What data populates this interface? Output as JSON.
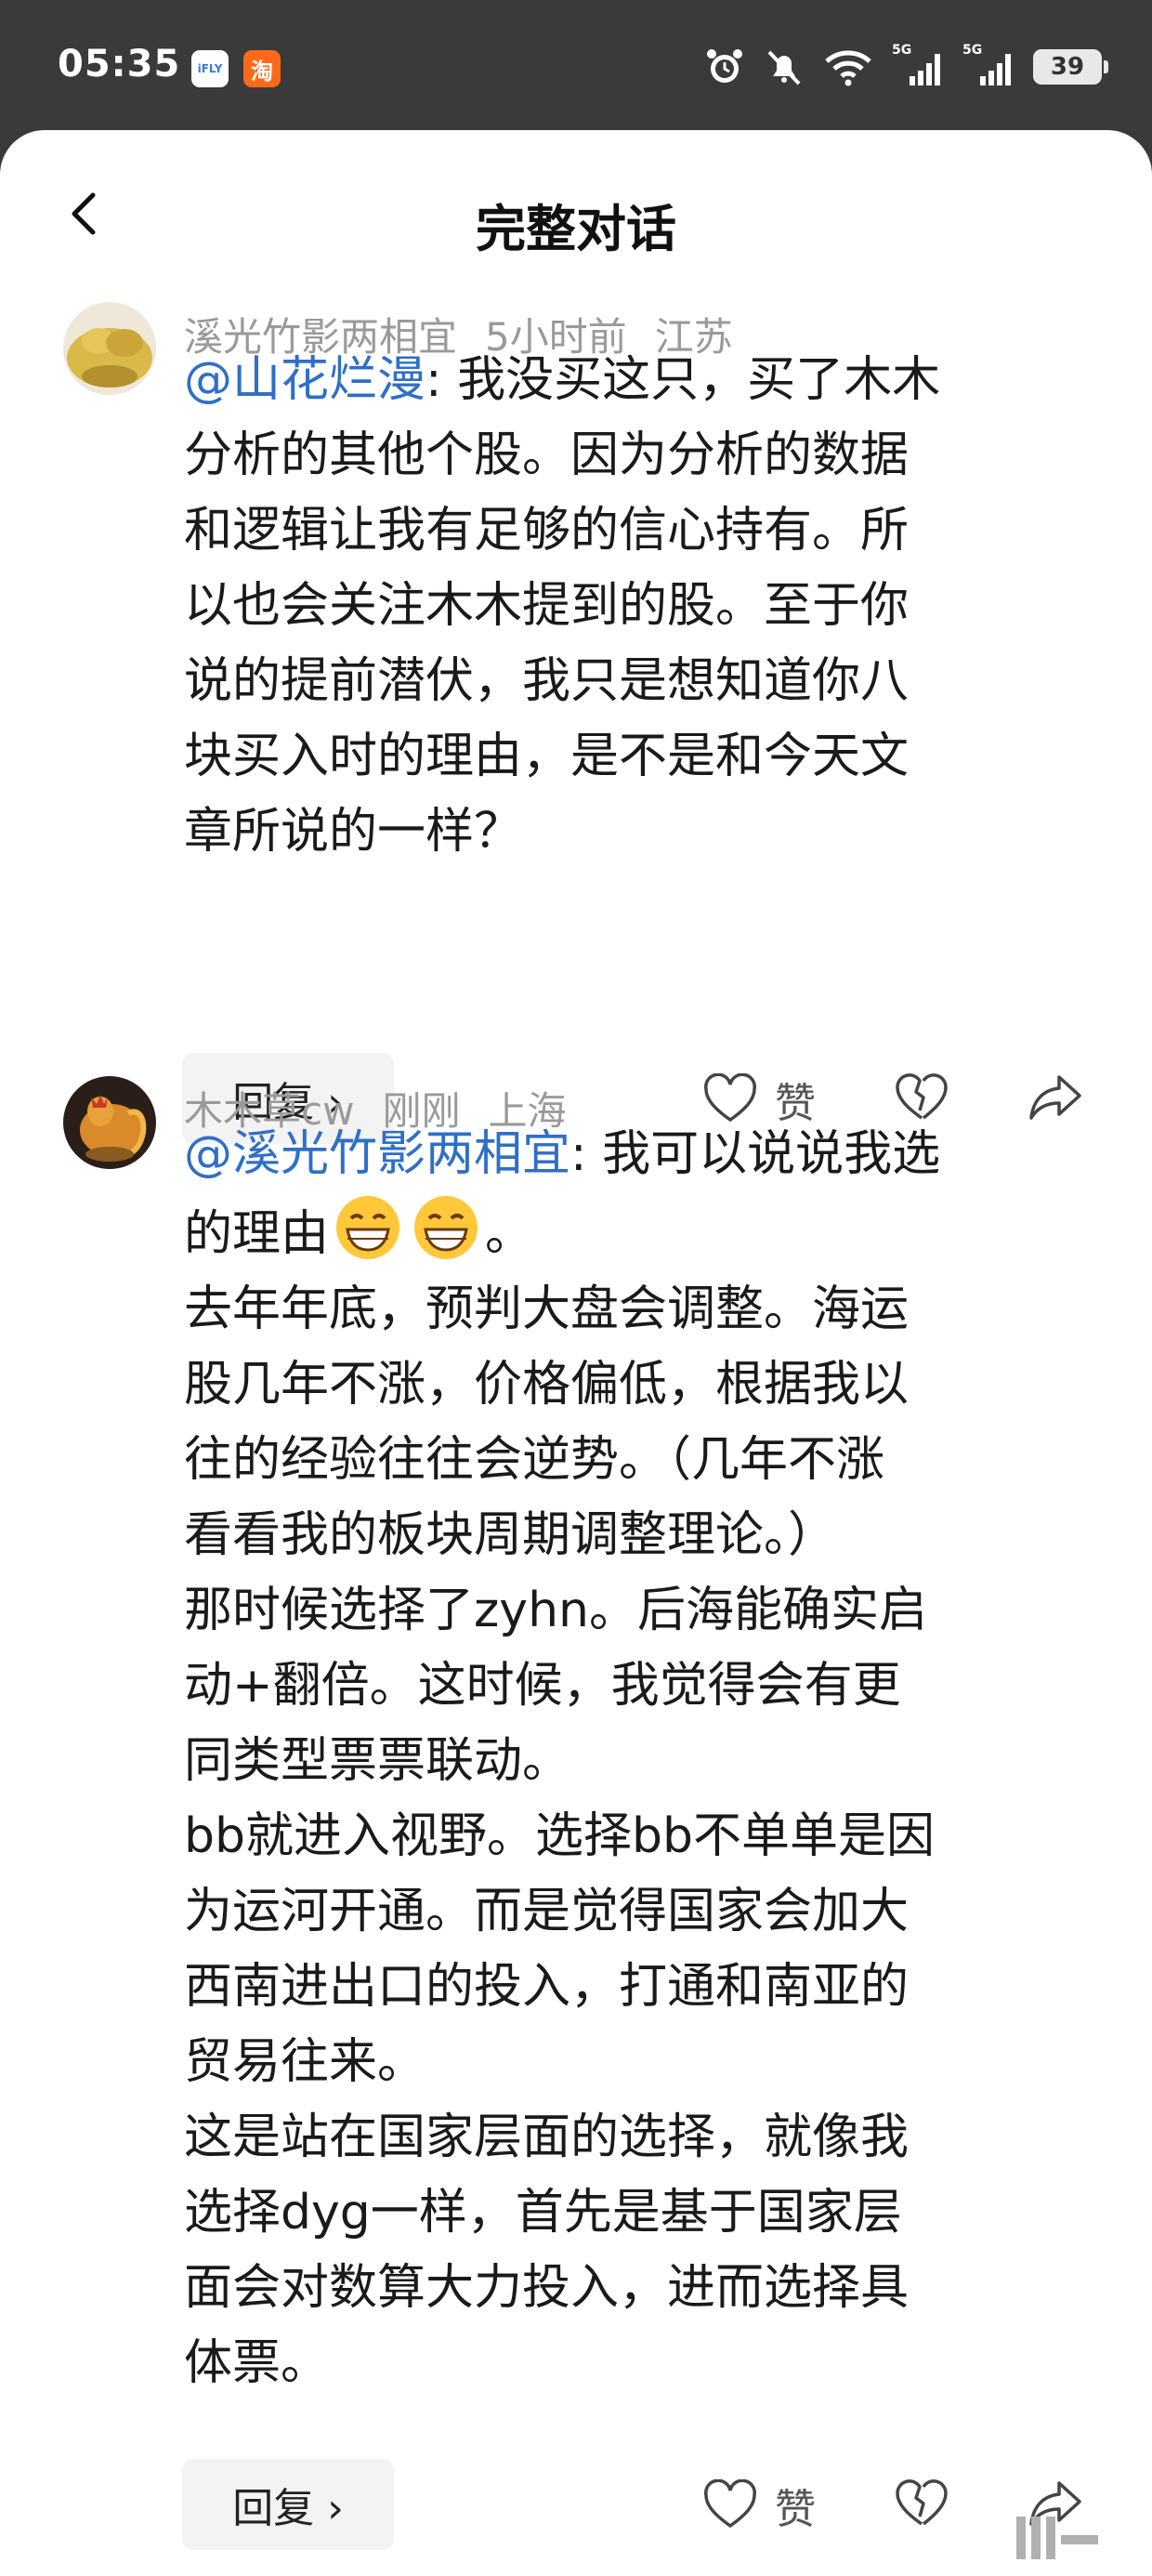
{
  "status_bar": {
    "time": "05:35",
    "app_badges": [
      "iFLY",
      "淘"
    ],
    "network_label_1": "5G",
    "network_label_2": "5G",
    "battery": "39"
  },
  "header": {
    "title": "完整对话"
  },
  "comments": [
    {
      "author": "溪光竹影两相宜",
      "time": "5小时前",
      "location": "江苏",
      "mention": "@山花烂漫",
      "lines": [
        ": 我没买这只，买了木木",
        "分析的其他个股。因为分析的数据",
        "和逻辑让我有足够的信心持有。所",
        "以也会关注木木提到的股。至于你",
        "说的提前潜伏，我只是想知道你八",
        "块买入时的理由，是不是和今天文",
        "章所说的一样？"
      ],
      "reply_label": "回复 ›",
      "like_label": "赞"
    },
    {
      "author": "木木草cw",
      "time": "刚刚",
      "location": "上海",
      "mention": "@溪光竹影两相宜",
      "lines": [
        ": 我可以说说我选",
        "的理由",
        "。",
        "去年年底，预判大盘会调整。海运",
        "股几年不涨，价格偏低，根据我以",
        "往的经验往往会逆势。（几年不涨",
        "看看我的板块周期调整理论。）",
        "那时候选择了zyhn。后海能确实启",
        "动+翻倍。这时候，我觉得会有更",
        "同类型票票联动。",
        "bb就进入视野。选择bb不单单是因",
        "为运河开通。而是觉得国家会加大",
        "西南进出口的投入，打通和南亚的",
        "贸易往来。",
        "这是站在国家层面的选择，就像我",
        "选择dyg一样，首先是基于国家层",
        "面会对数算大力投入，进而选择具",
        "体票。"
      ],
      "reply_label": "回复 ›",
      "like_label": "赞"
    }
  ],
  "colors": {
    "mention": "#2f6fc6",
    "meta": "#9a9a9a",
    "text": "#1a1a1a"
  },
  "icons": [
    "back-arrow-icon",
    "heart-icon",
    "broken-heart-icon",
    "share-icon",
    "alarm-icon",
    "mute-icon",
    "wifi-icon",
    "signal-icon",
    "grin-emoji-icon"
  ]
}
